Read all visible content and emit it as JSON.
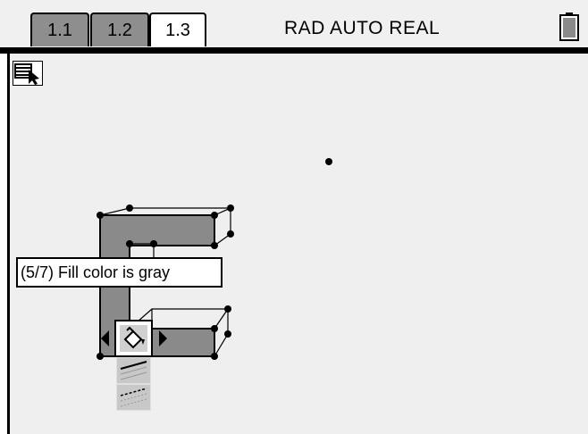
{
  "tabs": [
    {
      "label": "1.1",
      "active": false
    },
    {
      "label": "1.2",
      "active": false
    },
    {
      "label": "1.3",
      "active": true
    }
  ],
  "status": {
    "mode": "RAD AUTO REAL"
  },
  "tooltip": {
    "text": "(5/7) Fill color is gray"
  },
  "colors": {
    "fill": "#8a8a8a",
    "background": "#efefef",
    "tab_inactive": "#8e8e8e"
  },
  "icons": [
    "battery-icon",
    "tool-pointer-icon",
    "fill-bucket-icon",
    "arrow-left-icon",
    "arrow-right-icon"
  ]
}
